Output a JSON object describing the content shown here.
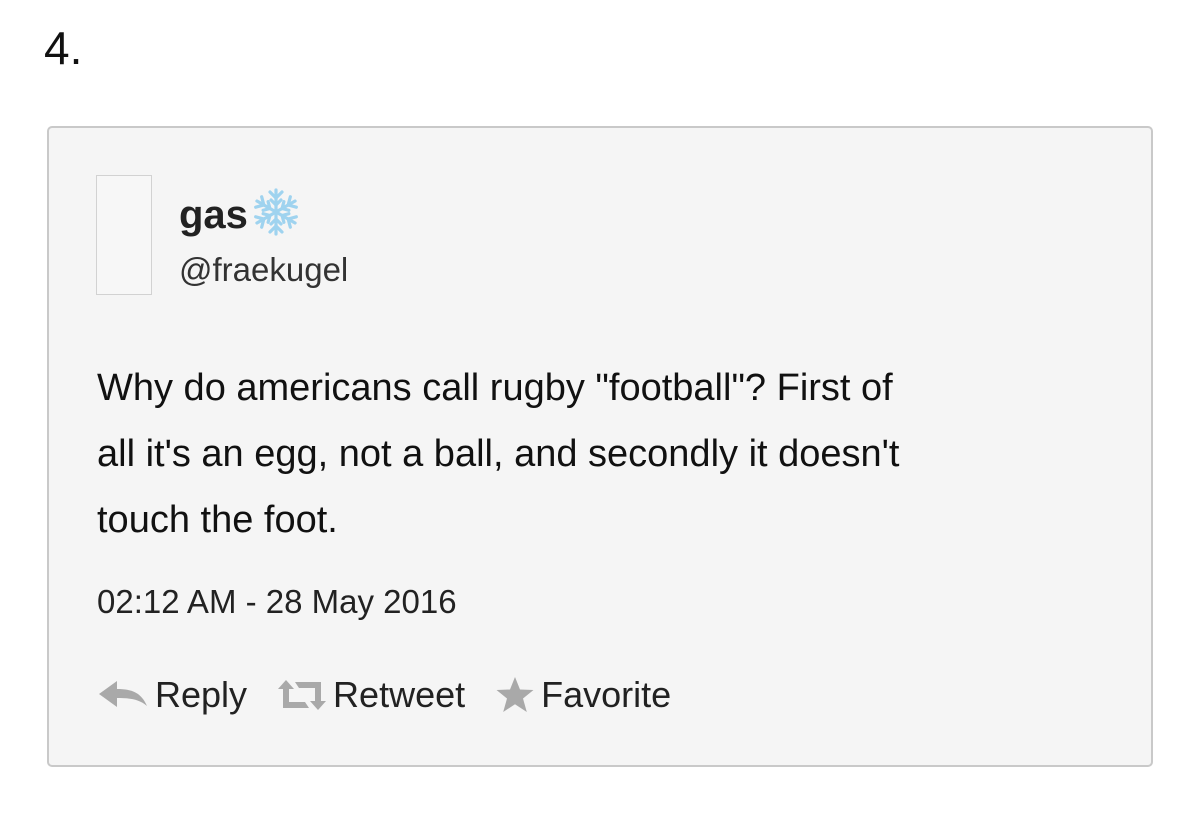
{
  "list_number": "4.",
  "tweet": {
    "display_name": "gas",
    "name_emoji": "snowflake-icon",
    "handle": "@fraekugel",
    "text": "Why do americans call rugby \"football\"? First of\nall it's an egg, not a ball, and secondly it doesn't\ntouch the foot.",
    "timestamp": "02:12 AM - 28 May 2016"
  },
  "actions": {
    "reply_label": "Reply",
    "reply_icon": "reply-arrow-icon",
    "retweet_label": "Retweet",
    "retweet_icon": "retweet-icon",
    "favorite_label": "Favorite",
    "favorite_icon": "star-icon"
  },
  "colors": {
    "card_background": "#f5f5f5",
    "card_border": "#c9c9c9",
    "icon_gray": "#a9a9a9",
    "snowflake": "#9fd3ef"
  }
}
